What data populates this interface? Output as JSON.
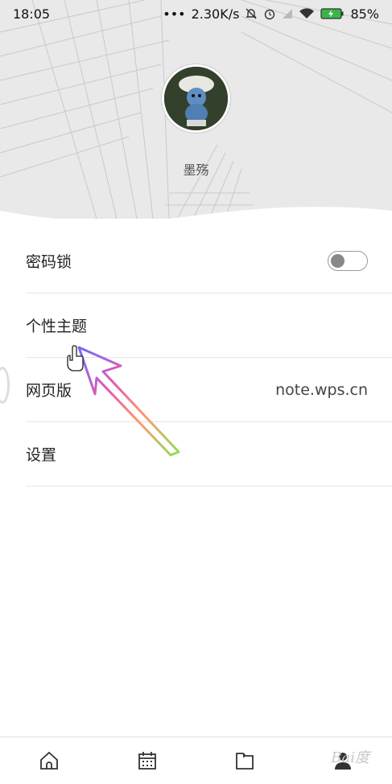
{
  "status_bar": {
    "time": "18:05",
    "dots": "•••",
    "network_speed": "2.30K/s",
    "battery_percent": "85%",
    "icons": [
      "mute-bell-icon",
      "alarm-icon",
      "signal-icon",
      "wifi-icon",
      "battery-charging-icon"
    ]
  },
  "profile": {
    "username": "墨殇"
  },
  "settings_list": [
    {
      "label": "密码锁",
      "type": "toggle",
      "toggle_on": false
    },
    {
      "label": "个性主题",
      "type": "link"
    },
    {
      "label": "网页版",
      "type": "value",
      "value": "note.wps.cn"
    },
    {
      "label": "设置",
      "type": "link"
    }
  ],
  "tab_bar": {
    "tabs": [
      "home-icon",
      "calendar-icon",
      "folder-icon",
      "profile-icon"
    ],
    "active_index": 3
  },
  "watermark": {
    "text": "Bai度"
  },
  "colors": {
    "header_bg": "#e9e9e9",
    "divider": "#e6e6e6",
    "toggle_off": "#888888"
  }
}
